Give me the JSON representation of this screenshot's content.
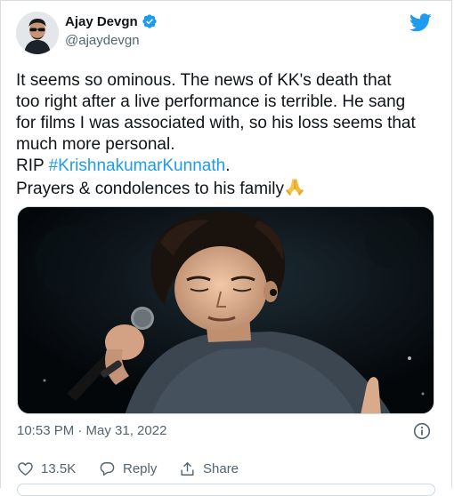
{
  "author": {
    "name": "Ajay Devgn",
    "handle": "@ajaydevgn",
    "verified": true
  },
  "tweet": {
    "lines": [
      "It seems so ominous. The news of KK's death that",
      "too right after a live performance is terrible. He sang",
      "for films I was associated with, so his loss seems that",
      "much more personal."
    ],
    "rip_prefix": "RIP ",
    "hashtag": "#KrishnakumarKunnath",
    "rip_suffix": ".",
    "closing": "Prayers & condolences to his family"
  },
  "meta": {
    "timestamp": "10:53 PM · May 31, 2022"
  },
  "actions": {
    "likes": "13.5K",
    "reply_label": "Reply",
    "share_label": "Share"
  },
  "icons": {
    "brand": "twitter-bird-icon",
    "verified": "verified-badge-icon",
    "info": "info-icon",
    "like": "heart-icon",
    "reply": "reply-bubble-icon",
    "share": "share-icon",
    "emoji": "folded-hands-emoji"
  },
  "colors": {
    "accent": "#1d9bf0",
    "text": "#0f1419",
    "secondary": "#536471"
  }
}
